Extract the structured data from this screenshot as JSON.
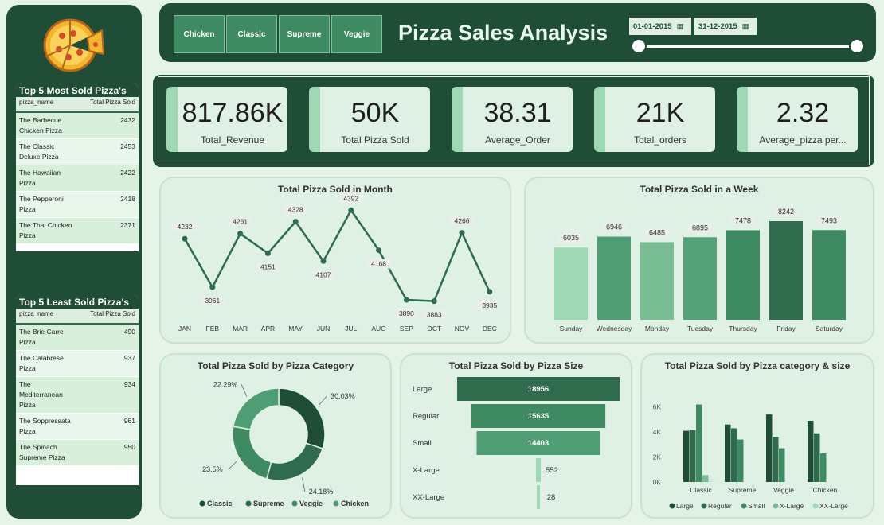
{
  "header": {
    "title": "Pizza Sales Analysis",
    "categories": [
      "Chicken",
      "Classic",
      "Supreme",
      "Veggie"
    ],
    "date_start": "01-01-2015",
    "date_end": "31-12-2015"
  },
  "top5_most": {
    "title": "Top 5 Most Sold Pizza's",
    "col_name": "pizza_name",
    "col_value": "Total Pizza Sold",
    "rows": [
      {
        "name": "The Barbecue Chicken Pizza",
        "value": "2432"
      },
      {
        "name": "The Classic Deluxe Pizza",
        "value": "2453"
      },
      {
        "name": "The Hawaiian Pizza",
        "value": "2422"
      },
      {
        "name": "The Pepperoni Pizza",
        "value": "2418"
      },
      {
        "name": "The Thai Chicken Pizza",
        "value": "2371"
      }
    ]
  },
  "top5_least": {
    "title": "Top 5 Least Sold Pizza's",
    "col_name": "pizza_name",
    "col_value": "Total Pizza Sold",
    "rows": [
      {
        "name": "The Brie Carre Pizza",
        "value": "490"
      },
      {
        "name": "The Calabrese Pizza",
        "value": "937"
      },
      {
        "name": "The Mediterranean Pizza",
        "value": "934"
      },
      {
        "name": "The Soppressata Pizza",
        "value": "961"
      },
      {
        "name": "The Spinach Supreme Pizza",
        "value": "950"
      }
    ]
  },
  "kpis": [
    {
      "value": "817.86K",
      "label": "Total_Revenue"
    },
    {
      "value": "50K",
      "label": "Total Pizza Sold"
    },
    {
      "value": "38.31",
      "label": "Average_Order"
    },
    {
      "value": "21K",
      "label": "Total_orders"
    },
    {
      "value": "2.32",
      "label": "Average_pizza per..."
    }
  ],
  "colors": {
    "dark": "#1f4d36",
    "mid": "#3e8a63",
    "light": "#9ed8b4",
    "bg": "#e5f3e8"
  },
  "chart_data": [
    {
      "type": "line",
      "title": "Total Pizza Sold in Month",
      "categories": [
        "JAN",
        "FEB",
        "MAR",
        "APR",
        "MAY",
        "JUN",
        "JUL",
        "AUG",
        "SEP",
        "OCT",
        "NOV",
        "DEC"
      ],
      "values": [
        4232,
        3961,
        4261,
        4151,
        4328,
        4107,
        4392,
        4168,
        3890,
        3883,
        4266,
        3935
      ],
      "ylim": [
        3850,
        4420
      ]
    },
    {
      "type": "bar",
      "title": "Total Pizza Sold in a Week",
      "categories": [
        "Sunday",
        "Wednesday",
        "Monday",
        "Tuesday",
        "Thursday",
        "Friday",
        "Saturday"
      ],
      "values": [
        6035,
        6946,
        6485,
        6895,
        7478,
        8242,
        7493
      ]
    },
    {
      "type": "pie",
      "title": "Total Pizza Sold by Pizza Category",
      "categories": [
        "Classic",
        "Supreme",
        "Veggie",
        "Chicken"
      ],
      "values": [
        30.03,
        24.18,
        23.5,
        22.29
      ],
      "labels": [
        "30.03%",
        "24.18%",
        "23.5%",
        "22.29%"
      ],
      "legend": "bottom"
    },
    {
      "type": "bar",
      "title": "Total Pizza Sold by Pizza Size",
      "orientation": "horizontal-funnel",
      "categories": [
        "Large",
        "Regular",
        "Small",
        "X-Large",
        "XX-Large"
      ],
      "values": [
        18956,
        15635,
        14403,
        552,
        28
      ]
    },
    {
      "type": "bar",
      "title": "Total Pizza Sold by Pizza category & size",
      "categories": [
        "Classic",
        "Supreme",
        "Veggie",
        "Chicken"
      ],
      "series": [
        {
          "name": "Large",
          "values": [
            4100,
            4600,
            5400,
            4900
          ]
        },
        {
          "name": "Regular",
          "values": [
            4150,
            4300,
            3600,
            3900
          ]
        },
        {
          "name": "Small",
          "values": [
            6200,
            3400,
            2700,
            2300
          ]
        },
        {
          "name": "X-Large",
          "values": [
            552,
            0,
            0,
            0
          ]
        },
        {
          "name": "XX-Large",
          "values": [
            28,
            0,
            0,
            0
          ]
        }
      ],
      "yticks": [
        "0K",
        "2K",
        "4K",
        "6K"
      ],
      "ylim": [
        0,
        7000
      ],
      "legend": "bottom"
    }
  ]
}
